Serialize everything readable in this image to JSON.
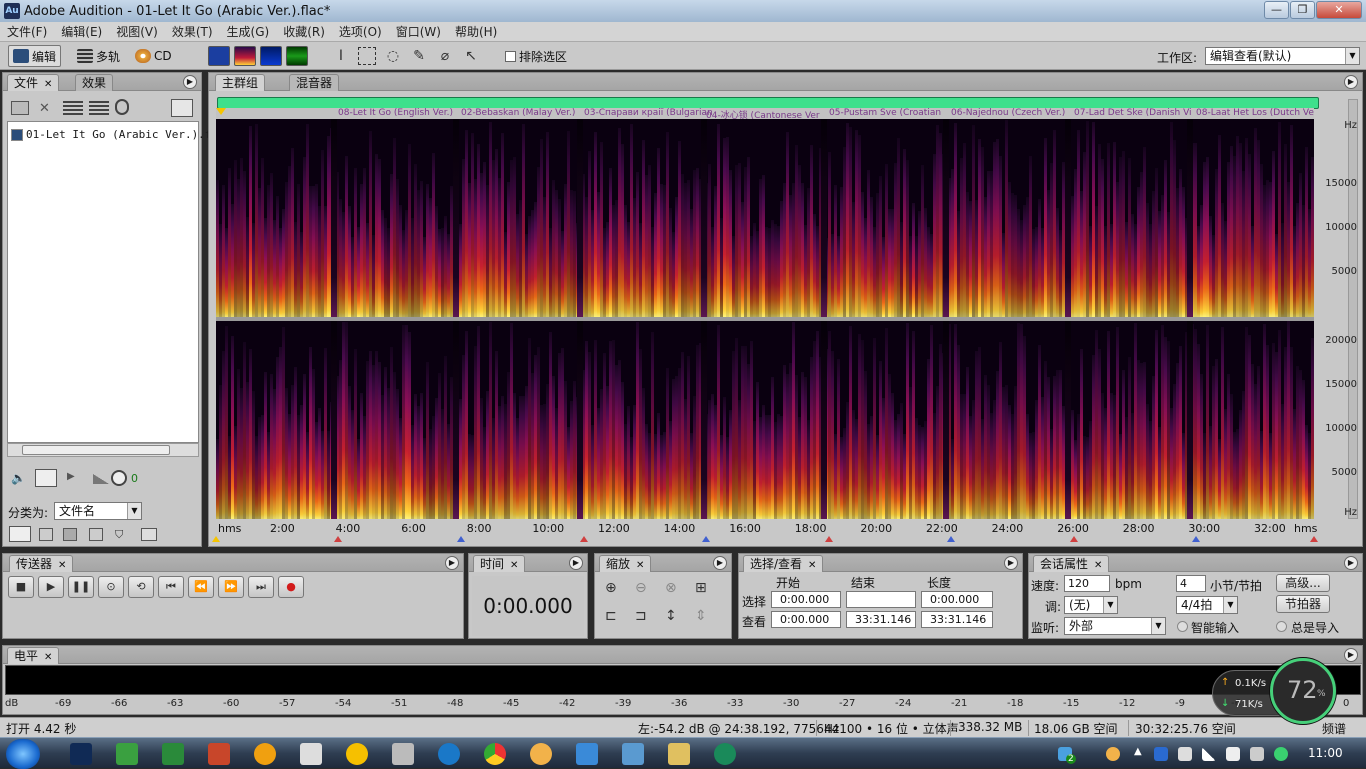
{
  "window": {
    "app_icon": "Au",
    "title": "Adobe Audition - 01-Let It Go (Arabic Ver.).flac*",
    "min": "—",
    "max": "❐",
    "close": "✕"
  },
  "menu": [
    "文件(F)",
    "编辑(E)",
    "视图(V)",
    "效果(T)",
    "生成(G)",
    "收藏(R)",
    "选项(O)",
    "窗口(W)",
    "帮助(H)"
  ],
  "toolbar": {
    "edit_label": "编辑",
    "multitrack_label": "多轨",
    "cd_label": "CD",
    "exclude_selection_label": "排除选区",
    "workspace_label": "工作区:",
    "workspace_value": "编辑查看(默认)"
  },
  "files_panel": {
    "tab_files": "文件",
    "tab_effects": "效果",
    "file_item": "01-Let It Go (Arabic Ver.).fl",
    "meter_value": "0",
    "sort_label": "分类为:",
    "sort_value": "文件名"
  },
  "main_panel": {
    "tab_main": "主群组",
    "tab_mixer": "混音器",
    "markers": [
      "08-Let It Go (English Ver.)",
      "02-Bebaskan (Malay Ver.)",
      "03-Спарави краії (Bulgarian",
      "04-冰心锁 (Cantonese Ver",
      "05-Pustam Sve (Croatian",
      "06-Najednou (Czech Ver.)",
      "07-Lad Det Ske (Danish Vi",
      "08-Laat Het Los (Dutch Ve"
    ],
    "freq_top": [
      "Hz",
      "15000",
      "10000",
      "5000"
    ],
    "freq_bottom": [
      "20000",
      "15000",
      "10000",
      "5000",
      "Hz"
    ],
    "time_ticks": [
      "hms",
      "2:00",
      "4:00",
      "6:00",
      "8:00",
      "10:00",
      "12:00",
      "14:00",
      "16:00",
      "18:00",
      "20:00",
      "22:00",
      "24:00",
      "26:00",
      "28:00",
      "30:00",
      "32:00",
      "hms"
    ]
  },
  "transport": {
    "title": "传送器"
  },
  "time_panel": {
    "title": "时间",
    "value": "0:00.000"
  },
  "zoom_panel": {
    "title": "缩放"
  },
  "selection_panel": {
    "title": "选择/查看",
    "col_start": "开始",
    "col_end": "结束",
    "col_length": "长度",
    "row_selection": "选择",
    "row_view": "查看",
    "sel_start": "0:00.000",
    "sel_end": "",
    "sel_length": "0:00.000",
    "view_start": "0:00.000",
    "view_end": "33:31.146",
    "view_length": "33:31.146"
  },
  "session_panel": {
    "title": "会话属性",
    "tempo_label": "速度:",
    "tempo_value": "120",
    "tempo_unit": "bpm",
    "beats_value": "4",
    "beats_label": "小节/节拍",
    "advanced_button": "高级...",
    "key_label": "调:",
    "key_value": "(无)",
    "time_sig_value": "4/4拍",
    "metronome_button": "节拍器",
    "monitor_label": "监听:",
    "monitor_value": "外部",
    "smart_input_label": "智能输入",
    "always_input_label": "总是导入"
  },
  "level_panel": {
    "title": "电平",
    "db_scale": [
      "dB",
      "-69",
      "-66",
      "-63",
      "-60",
      "-57",
      "-54",
      "-51",
      "-48",
      "-45",
      "-42",
      "-39",
      "-36",
      "-33",
      "-30",
      "-27",
      "-24",
      "-21",
      "-18",
      "-15",
      "-12",
      "-9",
      "-6",
      "-3",
      "0"
    ]
  },
  "status": {
    "open_time": "打开 4.42 秒",
    "cursor_info": "左:-54.2 dB @ 24:38.192, 7756Hz",
    "format": "44100 • 16 位 • 立体声",
    "file_size": "338.32 MB",
    "free_space": "18.06 GB 空间",
    "free_time": "30:32:25.76 空间",
    "spectral_label": "频谱"
  },
  "net_widget": {
    "up": "0.1K/s",
    "down": "71K/s",
    "percent": "72",
    "percent_sign": "%"
  },
  "taskbar": {
    "clock": "11:00",
    "badge": "2"
  },
  "colors": {
    "accent_green": "#3ee08c",
    "record_red": "#d21b1b",
    "spectro_low": "#fff47a",
    "spectro_high": "#1a0622"
  }
}
